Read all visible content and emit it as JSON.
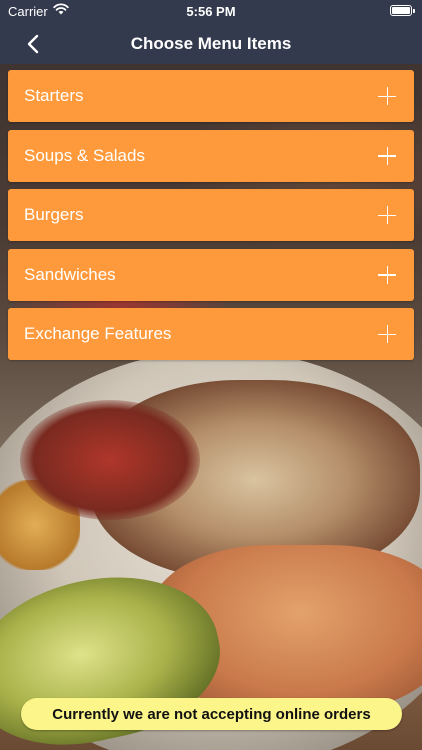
{
  "status_bar": {
    "carrier": "Carrier",
    "time": "5:56 PM"
  },
  "nav": {
    "title": "Choose Menu Items",
    "back_icon": "chevron-left-icon"
  },
  "menu": {
    "items": [
      {
        "label": "Starters",
        "icon": "plus-icon"
      },
      {
        "label": "Soups & Salads",
        "icon": "plus-icon"
      },
      {
        "label": "Burgers",
        "icon": "plus-icon"
      },
      {
        "label": "Sandwiches",
        "icon": "plus-icon"
      },
      {
        "label": "Exchange Features",
        "icon": "plus-icon"
      }
    ]
  },
  "notice": {
    "text": "Currently we are not accepting online orders"
  },
  "colors": {
    "nav_bar": "#343a4d",
    "menu_row": "#ff9a3c",
    "notice": "#fbf58a"
  }
}
